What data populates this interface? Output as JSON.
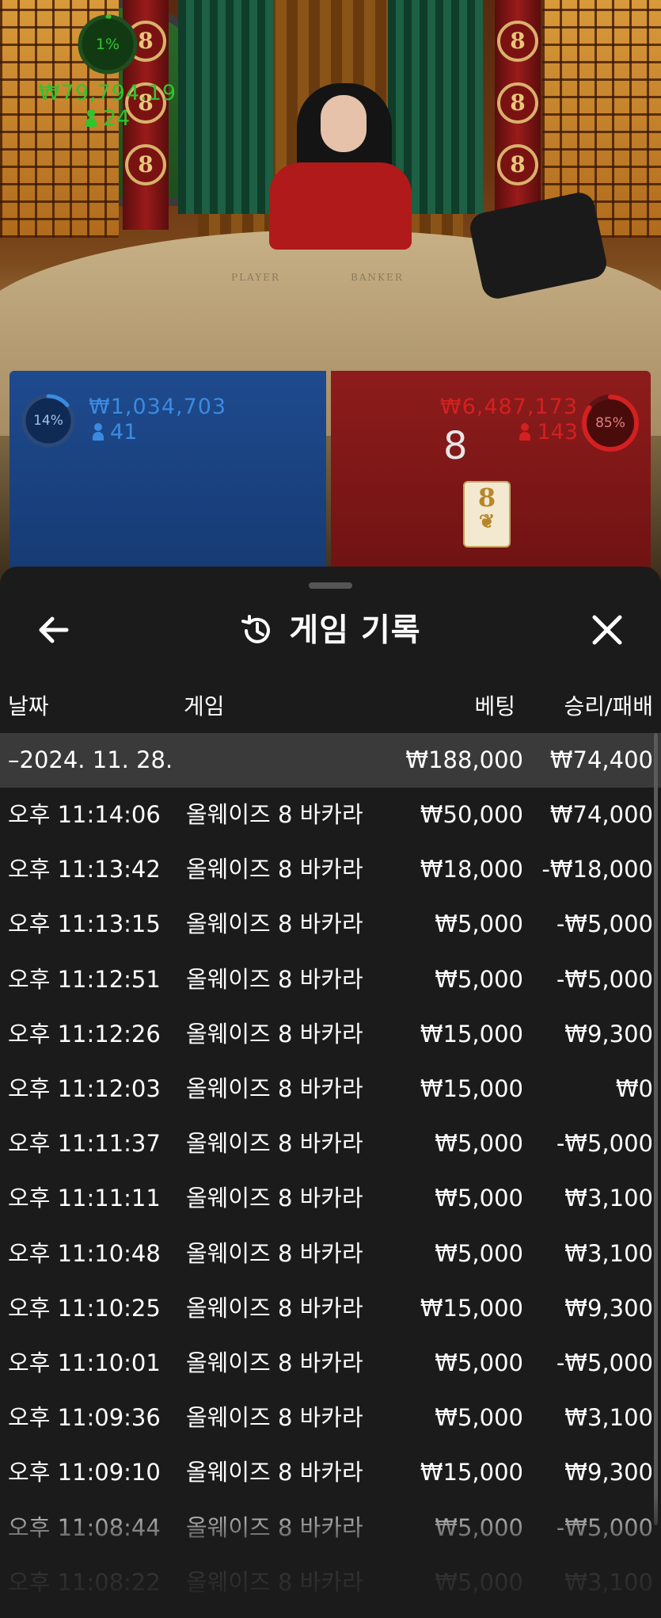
{
  "video": {
    "felt_player": "PLAYER",
    "felt_banker": "BANKER",
    "pillar_glyph": "8"
  },
  "bets": {
    "player": {
      "percent": "14%",
      "percent_value": 14,
      "amount": "₩1,034,703",
      "count": "41",
      "color": "#3a8be0"
    },
    "tie": {
      "percent": "1%",
      "percent_value": 1,
      "amount": "₩79,794.19",
      "count": "24",
      "color": "#2fc52f"
    },
    "banker": {
      "percent": "85%",
      "percent_value": 85,
      "amount": "₩6,487,173",
      "count": "143",
      "color": "#d42020",
      "score": "8",
      "card_rank": "8"
    }
  },
  "header": {
    "title": "게임 기록",
    "icons": {
      "back": "arrow-left-icon",
      "history": "history-icon",
      "close": "close-icon"
    }
  },
  "table": {
    "columns": {
      "date": "날짜",
      "game": "게임",
      "bet": "베팅",
      "result": "승리/패배"
    },
    "date_group": {
      "label": "–2024. 11. 28.",
      "bet_total": "₩188,000",
      "result_total": "₩74,400"
    },
    "rows": [
      {
        "time": "오후 11:14:06",
        "game": "올웨이즈 8 바카라",
        "bet": "₩50,000",
        "result": "₩74,000"
      },
      {
        "time": "오후 11:13:42",
        "game": "올웨이즈 8 바카라",
        "bet": "₩18,000",
        "result": "-₩18,000"
      },
      {
        "time": "오후 11:13:15",
        "game": "올웨이즈 8 바카라",
        "bet": "₩5,000",
        "result": "-₩5,000"
      },
      {
        "time": "오후 11:12:51",
        "game": "올웨이즈 8 바카라",
        "bet": "₩5,000",
        "result": "-₩5,000"
      },
      {
        "time": "오후 11:12:26",
        "game": "올웨이즈 8 바카라",
        "bet": "₩15,000",
        "result": "₩9,300"
      },
      {
        "time": "오후 11:12:03",
        "game": "올웨이즈 8 바카라",
        "bet": "₩15,000",
        "result": "₩0"
      },
      {
        "time": "오후 11:11:37",
        "game": "올웨이즈 8 바카라",
        "bet": "₩5,000",
        "result": "-₩5,000"
      },
      {
        "time": "오후 11:11:11",
        "game": "올웨이즈 8 바카라",
        "bet": "₩5,000",
        "result": "₩3,100"
      },
      {
        "time": "오후 11:10:48",
        "game": "올웨이즈 8 바카라",
        "bet": "₩5,000",
        "result": "₩3,100"
      },
      {
        "time": "오후 11:10:25",
        "game": "올웨이즈 8 바카라",
        "bet": "₩15,000",
        "result": "₩9,300"
      },
      {
        "time": "오후 11:10:01",
        "game": "올웨이즈 8 바카라",
        "bet": "₩5,000",
        "result": "-₩5,000"
      },
      {
        "time": "오후 11:09:36",
        "game": "올웨이즈 8 바카라",
        "bet": "₩5,000",
        "result": "₩3,100"
      },
      {
        "time": "오후 11:09:10",
        "game": "올웨이즈 8 바카라",
        "bet": "₩15,000",
        "result": "₩9,300"
      },
      {
        "time": "오후 11:08:44",
        "game": "올웨이즈 8 바카라",
        "bet": "₩5,000",
        "result": "-₩5,000"
      },
      {
        "time": "오후 11:08:22",
        "game": "올웨이즈 8 바카라",
        "bet": "₩5,000",
        "result": "₩3,100"
      }
    ]
  }
}
